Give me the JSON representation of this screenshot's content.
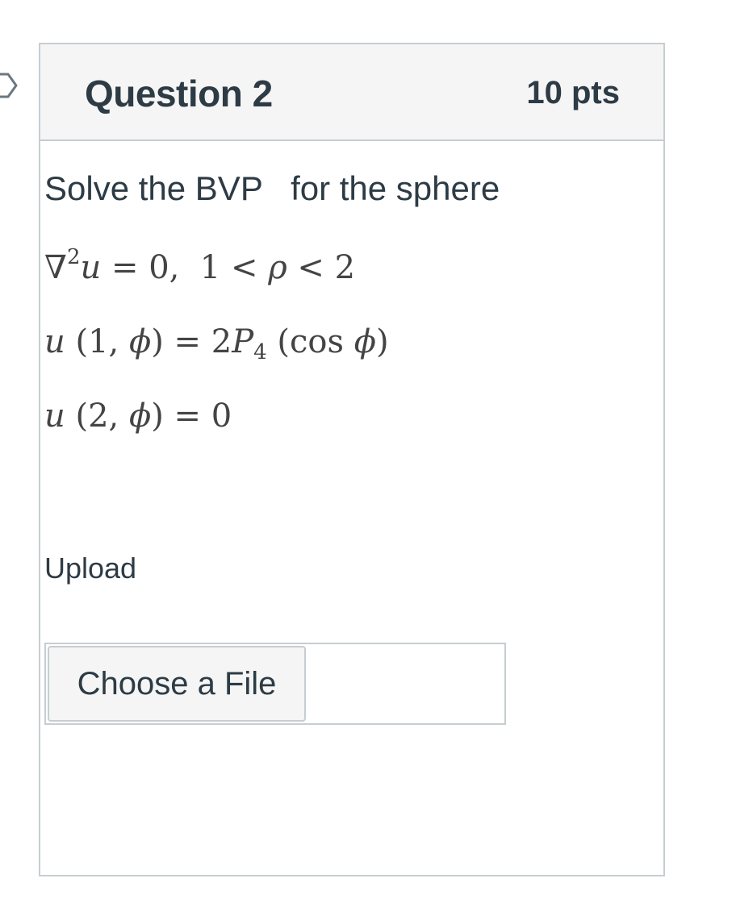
{
  "question": {
    "title": "Question 2",
    "points": "10 pts",
    "prompt": "Solve the BVP   for the sphere",
    "equations": {
      "line1": {
        "lhs_symbol": "∇",
        "lhs_exp": "2",
        "lhs_var": "u",
        "rest": " = 0,  1 < ",
        "rho": "ρ",
        "tail": " < 2"
      },
      "line2": {
        "fn": "u",
        "args_open": " (1, ",
        "phi": "ϕ",
        "args_close": ") = 2",
        "P": "P",
        "P_sub": "4",
        "cos_open": " (cos ",
        "phi2": "ϕ",
        "cos_close": ")"
      },
      "line3": {
        "fn": "u",
        "args_open": " (2, ",
        "phi": "ϕ",
        "args_close": ") = 0"
      }
    }
  },
  "upload": {
    "label": "Upload",
    "button_label": "Choose a File",
    "file_name": ""
  },
  "icons": {
    "flag": "question-flag-icon"
  },
  "colors": {
    "text": "#2d3b45",
    "border": "#c7cdd1",
    "header_bg": "#f5f5f5",
    "math": "#444444"
  }
}
